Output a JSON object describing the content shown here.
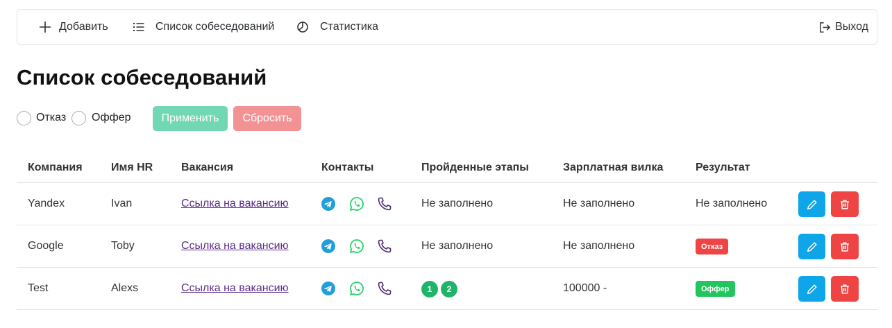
{
  "nav": {
    "add_label": "Добавить",
    "list_label": "Список собеседований",
    "stats_label": "Статистика",
    "logout_label": "Выход"
  },
  "page": {
    "title": "Список собеседований"
  },
  "filters": {
    "options": [
      "Отказ",
      "Оффер"
    ],
    "apply_label": "Применить",
    "reset_label": "Сбросить"
  },
  "table": {
    "headers": [
      "Компания",
      "Имя HR",
      "Вакансия",
      "Контакты",
      "Пройденные этапы",
      "Зарплатная вилка",
      "Результат"
    ],
    "rows": [
      {
        "company": "Yandex",
        "hr": "Ivan",
        "vacancy": "Ссылка на вакансию",
        "stages": "Не заполнено",
        "salary": "Не заполнено",
        "result": "Не заполнено"
      },
      {
        "company": "Google",
        "hr": "Toby",
        "vacancy": "Ссылка на вакансию",
        "stages": "Не заполнено",
        "salary": "Не заполнено",
        "result": "Отказ"
      },
      {
        "company": "Test",
        "hr": "Alexs",
        "vacancy": "Ссылка на вакансию",
        "stages": [
          "1",
          "2"
        ],
        "salary": "100000 -",
        "result": "Оффер"
      }
    ]
  },
  "colors": {
    "apply": "#72d7b3",
    "reset": "#f39294",
    "edit": "#0ea5e9",
    "delete": "#ef4444",
    "badge_reject": "#ef4444",
    "badge_offer": "#22c55e",
    "stage": "#20b46b",
    "telegram": "#229ed9",
    "whatsapp": "#25d366",
    "phone": "#4b2a6e"
  },
  "icons": {
    "nav": [
      "plus-icon",
      "list-icon",
      "pie-chart-icon",
      "logout-icon"
    ],
    "contacts": [
      "telegram-icon",
      "whatsapp-icon",
      "phone-icon"
    ],
    "actions": [
      "pencil-icon",
      "trash-icon"
    ]
  }
}
